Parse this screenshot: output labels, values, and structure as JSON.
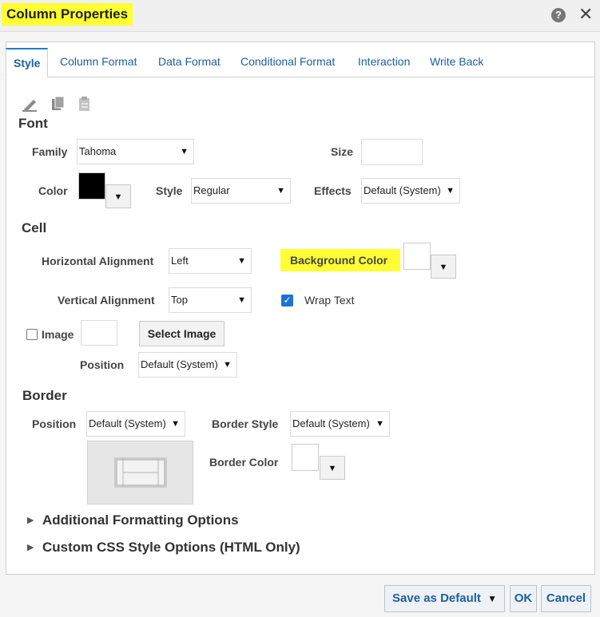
{
  "dialog": {
    "title": "Column Properties",
    "help_glyph": "?",
    "close_glyph": "✕"
  },
  "tabs": [
    {
      "label": "Style",
      "active": true
    },
    {
      "label": "Column Format"
    },
    {
      "label": "Data Format"
    },
    {
      "label": "Conditional Format"
    },
    {
      "label": "Interaction"
    },
    {
      "label": "Write Back"
    }
  ],
  "toolbar": {
    "icons": [
      "clear-format-icon",
      "copy-icon",
      "paste-icon"
    ]
  },
  "font": {
    "section_label": "Font",
    "family_label": "Family",
    "family_value": "Tahoma",
    "size_label": "Size",
    "size_value": "",
    "color_label": "Color",
    "color_value": "#000000",
    "style_label": "Style",
    "style_value": "Regular",
    "effects_label": "Effects",
    "effects_value": "Default (System)"
  },
  "cell": {
    "section_label": "Cell",
    "h_align_label": "Horizontal Alignment",
    "h_align_value": "Left",
    "bg_color_label": "Background Color",
    "bg_color_value": "#ffffff",
    "v_align_label": "Vertical Alignment",
    "v_align_value": "Top",
    "wrap_text_label": "Wrap Text",
    "wrap_text_checked": true,
    "image_label": "Image",
    "image_checked": false,
    "select_image_label": "Select Image",
    "position_label": "Position",
    "position_value": "Default (System)"
  },
  "border": {
    "section_label": "Border",
    "position_label": "Position",
    "position_value": "Default (System)",
    "style_label": "Border Style",
    "style_value": "Default (System)",
    "color_label": "Border Color",
    "color_value": "#ffffff"
  },
  "expanders": {
    "additional": "Additional Formatting Options",
    "custom_css": "Custom CSS Style Options (HTML Only)"
  },
  "footer": {
    "save_default": "Save as Default",
    "ok": "OK",
    "cancel": "Cancel"
  },
  "colors": {
    "highlight": "#ffff33",
    "link_blue": "#1c5f9e",
    "checkbox_blue": "#1c73d4"
  }
}
